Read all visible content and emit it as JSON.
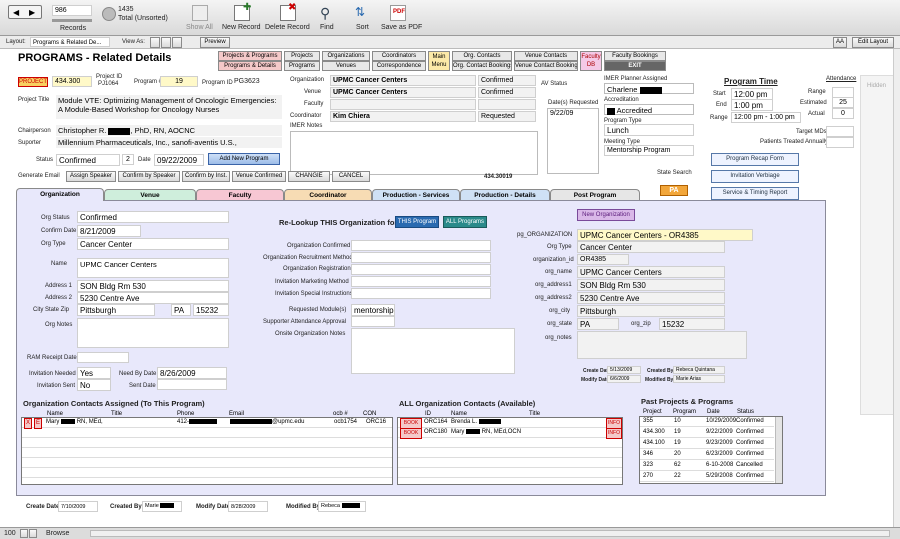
{
  "toolbar": {
    "record_number": "986",
    "records_label": "Records",
    "found_count": "1435",
    "total_label": "Total (Unsorted)",
    "show_all": "Show All",
    "new_record": "New Record",
    "delete_record": "Delete Record",
    "find": "Find",
    "sort": "Sort",
    "save_pdf": "Save as PDF"
  },
  "subbar": {
    "layout_label": "Layout:",
    "layout_value": "Programs & Related De...",
    "view_as": "View As:",
    "preview": "Preview",
    "aa": "AA",
    "edit_layout": "Edit Layout"
  },
  "header": {
    "title": "PROGRAMS - Related Details"
  },
  "nav": {
    "projects_programs": "Projects & Programs",
    "programs_details": "Programs & Details",
    "projects": "Projects",
    "programs": "Programs",
    "organizations": "Organizations",
    "venues": "Venues",
    "coordinators": "Coordinators",
    "correspondence": "Correspondence",
    "main_menu": "Main Menu",
    "org_contacts": "Org. Contacts",
    "org_contact_bookings": "Org. Contact Bookings",
    "venue_contacts": "Venue Contacts",
    "venue_contact_bookings": "Venue Contact Bookings",
    "faculty_db": "Faculty DB",
    "faculty_bookings": "Faculty Bookings",
    "exit": "EXIT"
  },
  "top": {
    "project_badge": "PROJECT",
    "project_num": "434.300",
    "project_id_label": "Project ID",
    "project_id": "PJ1064",
    "program_num_label": "Program #",
    "program_num": "19",
    "program_id_label": "Program ID",
    "program_id": "PG3623",
    "project_title_label": "Project Title",
    "project_title": "Module VTE: Optimizing Management of Oncologic Emergencies: A Module-Based Workshop for Oncology Nurses",
    "chairperson_label": "Chairperson",
    "chairperson_pre": "Christopher R.",
    "chairperson_post": ", PhD, RN, AOCNC",
    "supporter_label": "Suporter",
    "supporter": "Millennium Pharmaceuticals, Inc., sanofi-aventis U.S.,",
    "status_label": "Status",
    "status": "Confirmed",
    "status_num": "2",
    "date_label": "Date",
    "date": "09/22/2009",
    "add_program": "Add New Program"
  },
  "summary": {
    "org_label": "Organization",
    "org": "UPMC Cancer Centers",
    "org_status": "Confirmed",
    "venue_label": "Venue",
    "venue": "UPMC Cancer Centers",
    "venue_status": "Confirmed",
    "faculty_label": "Faculty",
    "coordinator_label": "Coordinator",
    "coordinator": "Kim Chiera",
    "coord_status": "Requested",
    "imer_notes_label": "IMER Notes",
    "av_status_label": "AV Status",
    "dates_req_label": "Date(s) Requested",
    "dates_req": "9/22/09",
    "planner_label": "IMER Planner Assigned",
    "planner": "Charlene",
    "accreditation_label": "Accreditation",
    "accreditation": "Accredited",
    "program_type_label": "Program Type",
    "program_type": "Lunch",
    "meeting_type_label": "Meeting Type",
    "meeting_type": "Mentorship Program",
    "program_time": "Program Time",
    "start_label": "Start",
    "start": "12:00 pm",
    "end_label": "End",
    "end": "1:00 pm",
    "range_label": "Range",
    "range": "12:00 pm - 1:00 pm",
    "attendance": "Attendance",
    "att_range": "Range",
    "estimated": "Estimated",
    "estimated_val": "25",
    "actual": "Actual",
    "actual_val": "0",
    "target_mds": "Target MDs",
    "patients_treated": "Patients Treated Annually",
    "hidden": "Hidden"
  },
  "email": {
    "generate": "Generate Email",
    "assign_speaker": "Assign Speaker",
    "confirm_speaker": "Confirm by Speaker",
    "confirm_inst": "Confirm by Inst.",
    "venue_confirmed": "Venue Confirmed",
    "change": "CHANGIE",
    "cancel": "CANCEL",
    "code": "434.30019",
    "state_search": "State Search",
    "state": "PA"
  },
  "side_buttons": [
    "Program Recap Form",
    "Invitation Verbiage",
    "Service & Timing Report"
  ],
  "tabs": [
    "Organization",
    "Venue",
    "Faculty",
    "Coordinator",
    "Production - Services",
    "Production - Details",
    "Post Program"
  ],
  "org": {
    "org_status_label": "Org Status",
    "org_status": "Confirmed",
    "confirm_date_label": "Confirm Date",
    "confirm_date": "8/21/2009",
    "org_type_label": "Org Type",
    "org_type": "Cancer Center",
    "name_label": "Name",
    "name": "UPMC Cancer Centers",
    "addr1_label": "Address 1",
    "addr1": "SON Bldg Rm 530",
    "addr2_label": "Address 2",
    "addr2": "5230 Centre Ave",
    "csz_label": "City State Zip",
    "city": "Pittsburgh",
    "state": "PA",
    "zip": "15232",
    "notes_label": "Org Notes",
    "ram_label": "RAM Receipt Date",
    "inv_needed_label": "Invitation Needed",
    "inv_needed": "Yes",
    "need_by_label": "Need By Date",
    "need_by": "8/26/2009",
    "inv_sent_label": "Invitation Sent",
    "inv_sent": "No",
    "sent_date_label": "Sent Date"
  },
  "relookup": {
    "title": "Re-Lookup THIS Organization for:",
    "this_program": "THIS Program",
    "all_programs": "ALL Programs",
    "org_confirmed": "Organization Confirmed",
    "recruit": "Organization Recruitment Method",
    "registration": "Organization Registration",
    "inv_marketing": "Invitation Marketing Method",
    "inv_special": "Invitation Special Instructions",
    "requested_modules": "Requested Module(s)",
    "requested_modules_val": "mentorship",
    "supporter_approval": "Supporter Attendance Approval",
    "onsite_notes": "Onsite Organization Notes"
  },
  "pgorg": {
    "new_org": "New Organization",
    "pg_org_label": "pg_ORGANIZATION",
    "pg_org": "UPMC Cancer Centers - OR4385",
    "org_type_label": "Org Type",
    "org_type": "Cancer Center",
    "org_id_label": "organization_id",
    "org_id": "OR4385",
    "org_name_label": "org_name",
    "org_name": "UPMC Cancer Centers",
    "addr1_label": "org_address1",
    "addr1": "SON Bldg Rm 530",
    "addr2_label": "org_address2",
    "addr2": "5230 Centre Ave",
    "city_label": "org_city",
    "city": "Pittsburgh",
    "state_label": "org_state",
    "state": "PA",
    "zip_label": "org_zip",
    "zip": "15232",
    "notes_label": "org_notes",
    "create_date_label": "Create Date",
    "create_date": "5/13/2009",
    "modify_date_label": "Modify Date",
    "modify_date": "6/6/2009",
    "created_by_label": "Created By",
    "created_by": "Rebeca Quintana",
    "modified_by_label": "Modified By",
    "modified_by": "Marie Arias"
  },
  "contacts_assigned": {
    "title": "Organization Contacts Assigned (To This Program)",
    "headers": [
      "Name",
      "Title",
      "Phone",
      "Email",
      "ocb #",
      "CON"
    ],
    "row": {
      "x": "X",
      "e": "E",
      "name_pre": "Mary",
      "name_post": "RN, MEd,",
      "phone": "412-",
      "email": "@upmc.edu",
      "ocb": "ocb1754",
      "con": "ORC16"
    }
  },
  "all_contacts": {
    "title": "ALL Organization Contacts (Available)",
    "headers": [
      "ID",
      "Name",
      "Title"
    ],
    "rows": [
      {
        "book": "BOOK",
        "id": "ORC164",
        "name_pre": "Brenda L.",
        "name_post": "",
        "info": "INFO"
      },
      {
        "book": "BOOK",
        "id": "ORC180",
        "name_pre": "Mary",
        "name_post": "RN, MEd,OCN",
        "info": "INFO"
      }
    ]
  },
  "past": {
    "title": "Past Projects & Programs",
    "headers": [
      "Project",
      "Program",
      "Date",
      "Status"
    ],
    "rows": [
      [
        "355",
        "10",
        "10/29/2009",
        "Confirmed"
      ],
      [
        "434.300",
        "19",
        "9/22/2009",
        "Confirmed"
      ],
      [
        "434.100",
        "19",
        "9/23/2009",
        "Confirmed"
      ],
      [
        "346",
        "20",
        "6/23/2009",
        "Confirmed"
      ],
      [
        "323",
        "62",
        "6-10-2008",
        "Cancelled"
      ],
      [
        "270",
        "22",
        "5/29/2008",
        "Confirmed"
      ]
    ]
  },
  "footer": {
    "create_date_label": "Create Date",
    "create_date": "7/10/2009",
    "created_by_label": "Created By",
    "created_by": "Marie",
    "modify_date_label": "Modify Date",
    "modify_date": "8/28/2009",
    "modified_by_label": "Modified By",
    "modified_by": "Rebeca"
  },
  "status_bar": {
    "zoom": "100",
    "mode": "Browse"
  }
}
